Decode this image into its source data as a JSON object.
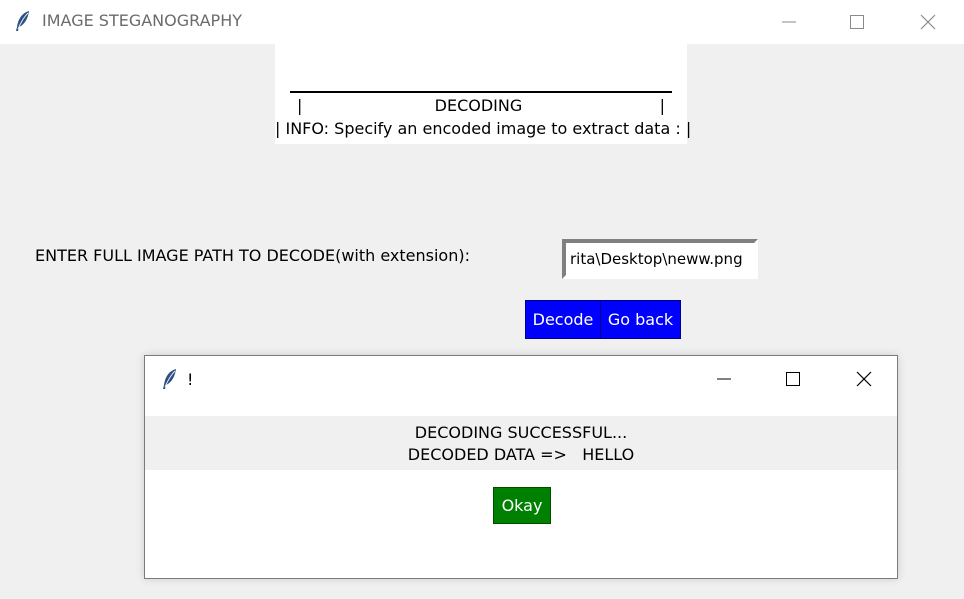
{
  "window": {
    "title": "IMAGE STEGANOGRAPHY",
    "icon": "feather-icon"
  },
  "header": {
    "title": "|                          DECODING                           |",
    "info": "| INFO: Specify an encoded image to extract data : |"
  },
  "form": {
    "path_label": "ENTER FULL IMAGE PATH TO DECODE(with extension):",
    "path_value": "rita\\Desktop\\neww.png",
    "decode_label": "Decode",
    "back_label": "Go back"
  },
  "dialog": {
    "title": "!",
    "icon": "feather-icon",
    "message_line1": "DECODING SUCCESSFUL...",
    "message_line2": "DECODED DATA =>   HELLO",
    "okay_label": "Okay"
  },
  "colors": {
    "button_blue": "#0000ff",
    "button_green": "#008000",
    "background": "#f0f0f0"
  }
}
